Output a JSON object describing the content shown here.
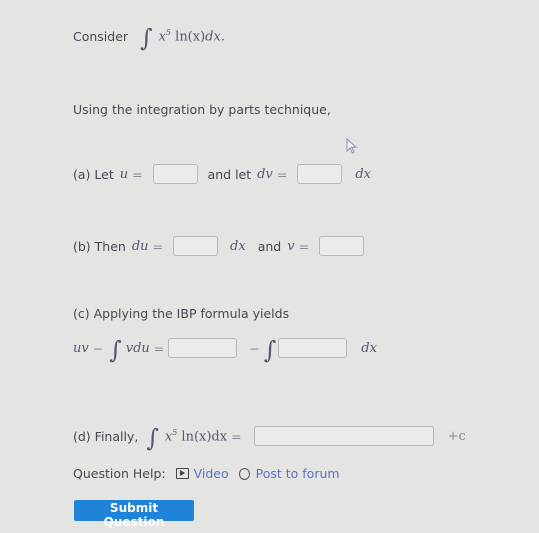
{
  "intro": {
    "consider_label": "Consider",
    "integrand": {
      "base": "x",
      "exp": "5",
      "fn": "ln(x)",
      "diff": "dx."
    }
  },
  "instruction": "Using the integration by parts technique,",
  "part_a": {
    "prefix": "(a) Let",
    "u_var": "u",
    "eq": "=",
    "middle": "and let",
    "dv_var": "dv",
    "suffix": "dx",
    "u_value": "",
    "dv_value": ""
  },
  "part_b": {
    "prefix": "(b) Then",
    "du_var": "du",
    "eq": "=",
    "dx": "dx",
    "middle": "and",
    "v_var": "v",
    "du_value": "",
    "v_value": ""
  },
  "part_c": {
    "heading": "(c) Applying the IBP formula yields",
    "lhs_uv": "uv",
    "minus": "−",
    "lhs_int": "vdu",
    "eq": "=",
    "dx": "dx",
    "first_value": "",
    "second_value": ""
  },
  "part_d": {
    "prefix": "(d) Finally,",
    "base": "x",
    "exp": "5",
    "fn": "ln(x)dx",
    "eq": "=",
    "suffix": "+c",
    "answer_value": ""
  },
  "help": {
    "label": "Question Help:",
    "video_label": "Video",
    "forum_label": "Post to forum"
  },
  "submit_label": "Submit Question"
}
